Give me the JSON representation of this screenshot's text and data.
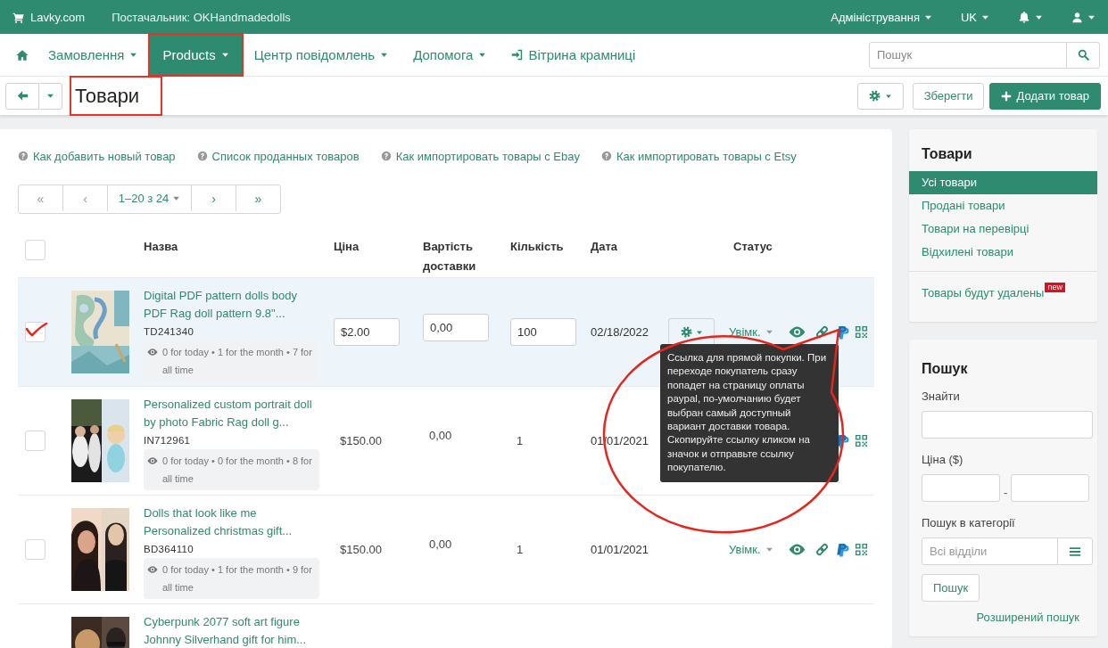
{
  "topbar": {
    "brand": "Lavky.com",
    "supplier": "Постачальник: OKHandmadedolls",
    "menus": [
      {
        "label": "Адміністрування",
        "kind": "text"
      },
      {
        "label": "UK",
        "kind": "text"
      },
      {
        "kind": "bell"
      },
      {
        "kind": "user"
      }
    ]
  },
  "nav": {
    "items": [
      {
        "label": "Замовлення",
        "kind": "dropdown",
        "selected": false,
        "highlighted": false
      },
      {
        "label": "Products",
        "kind": "dropdown",
        "selected": true,
        "highlighted": true
      },
      {
        "label": "Центр повідомлень",
        "kind": "dropdown",
        "selected": false,
        "highlighted": false
      },
      {
        "label": "Допомога",
        "kind": "dropdown",
        "selected": false,
        "highlighted": false
      },
      {
        "label": "Вітрина крамниці",
        "kind": "link",
        "selected": false,
        "highlighted": false
      }
    ],
    "search": {
      "placeholder": "Пошук"
    }
  },
  "toolbar": {
    "title": "Товари",
    "title_highlighted": true,
    "save": "Зберегти",
    "add": "Додати товар"
  },
  "help_links": [
    "Как добавить новый товар",
    "Список проданных товаров",
    "Как импортировать товары с Ebay",
    "Как импортировать товары с Etsy"
  ],
  "pagination": [
    {
      "label": "«",
      "kind": "arrow",
      "disabled": true
    },
    {
      "label": "‹",
      "kind": "arrow",
      "disabled": true
    },
    {
      "label": "1–20 з 24",
      "kind": "dropdown",
      "disabled": false
    },
    {
      "label": "›",
      "kind": "arrow",
      "disabled": false
    },
    {
      "label": "»",
      "kind": "arrow",
      "disabled": false
    }
  ],
  "table": {
    "select_all": {
      "checked": false
    },
    "columns": [
      "Назва",
      "Ціна",
      "Вартість доставки",
      "Кількість",
      "Дата",
      "Статус"
    ],
    "rows": [
      {
        "kind": "editable",
        "selected": true,
        "checked": true,
        "title": "Digital PDF pattern dolls body PDF Rag doll pattern 9.8\"...",
        "sku": "TD241340",
        "stats": "0 for today • 1 for the month • 7 for all time",
        "price": "$2.00",
        "delivery": "0,00",
        "quantity": "100",
        "date": "02/18/2022",
        "status": "Увімк.",
        "actions": [
          {
            "kind": "eye"
          },
          {
            "kind": "link"
          },
          {
            "kind": "payment"
          },
          {
            "kind": "qr"
          }
        ]
      },
      {
        "kind": "plain",
        "selected": false,
        "checked": false,
        "title": "Personalized custom portrait doll by photo Fabric Rag doll g...",
        "sku": "IN712961",
        "stats": "0 for today • 0 for the month • 8 for all time",
        "price": "$150.00",
        "delivery": "0,00",
        "quantity": "1",
        "date": "01/01/2021",
        "actions": [
          {
            "kind": "payment"
          },
          {
            "kind": "qr"
          }
        ]
      },
      {
        "kind": "plain",
        "selected": false,
        "checked": false,
        "title": "Dolls that look like me Personalized christmas gift...",
        "sku": "BD364110",
        "stats": "0 for today • 1 for the month • 9 for all time",
        "price": "$150.00",
        "delivery": "0,00",
        "quantity": "1",
        "date": "01/01/2021",
        "status": "Увімк.",
        "actions": [
          {
            "kind": "eye"
          },
          {
            "kind": "link"
          },
          {
            "kind": "payment"
          },
          {
            "kind": "qr"
          }
        ]
      },
      {
        "kind": "plain",
        "selected": false,
        "title": "Cyberpunk 2077 soft art figure Johnny Silverhand gift for him..."
      }
    ]
  },
  "tooltip": {
    "text": "Ссылка для прямой покупки. При переходе покупатель сразу попадет на страницу оплаты paypal, по-умолчанию будет выбран самый доступный вариант доставки товара. Скопируйте ссылку кликом на значок и отправьте ссылку покупателю.",
    "circled": true
  },
  "sidebar": {
    "title": "Товари",
    "items": [
      {
        "label": "Усі товари",
        "selected": true
      },
      {
        "label": "Продані товари",
        "selected": false
      },
      {
        "label": "Товари на перевірці",
        "selected": false
      },
      {
        "label": "Відхилені товари",
        "selected": false
      }
    ],
    "extra": {
      "label": "Товары будут удалены",
      "badge": "new"
    }
  },
  "search_panel": {
    "title": "Пошук",
    "find_label": "Знайти",
    "price_label": "Ціна ($)",
    "separator": "-",
    "category_label": "Пошук в категорії",
    "category_placeholder": "Всі відділи",
    "button": "Пошук",
    "advanced": "Розширений пошук"
  }
}
